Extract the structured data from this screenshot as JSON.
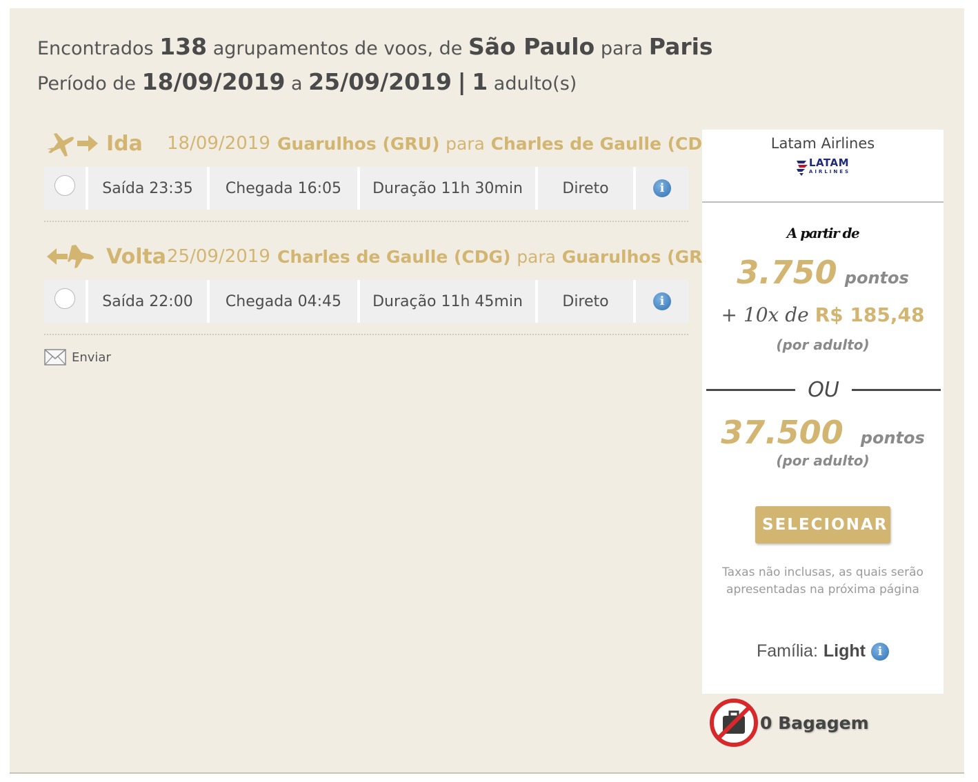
{
  "header": {
    "line1": {
      "t1": "Encontrados",
      "count": "138",
      "t2": "agrupamentos de voos, de",
      "origin": "São Paulo",
      "t3": "para",
      "destination": "Paris"
    },
    "line2": {
      "t1": "Período de",
      "start": "18/09/2019",
      "t2": "a",
      "end": "25/09/2019",
      "sep": "|",
      "adults": "1",
      "t3": "adulto(s)"
    }
  },
  "outbound": {
    "label": "Ida",
    "date": "18/09/2019",
    "from": "Guarulhos (GRU)",
    "para": "para",
    "to": "Charles de Gaulle (CDG)",
    "departure": "Saída 23:35",
    "arrival": "Chegada 16:05",
    "duration": "Duração 11h 30min",
    "type": "Direto"
  },
  "return": {
    "label": "Volta",
    "date": "25/09/2019",
    "from": "Charles de Gaulle (CDG)",
    "para": "para",
    "to": "Guarulhos (GRU)",
    "departure": "Saída 22:00",
    "arrival": "Chegada 04:45",
    "duration": "Duração 11h 45min",
    "type": "Direto"
  },
  "send_label": "Enviar",
  "sidebar": {
    "airline": "Latam Airlines",
    "logo_text": "LATAM",
    "logo_sub": "AIRLINES",
    "from_label": "A partir de",
    "points1": "3.750",
    "points_label": "pontos",
    "plus_text": "+ 10x de",
    "installment": "R$ 185,48",
    "per_adult": "(por adulto)",
    "or": "OU",
    "points2": "37.500",
    "select": "SELECIONAR",
    "taxes": "Taxas não inclusas, as quais serão apresentadas na próxima página",
    "family_label": "Família:",
    "family": "Light",
    "baggage": "0 Bagagem"
  },
  "colors": {
    "gold": "#d3b572",
    "background": "#f2ede3",
    "info_blue": "#2f6fb0"
  }
}
